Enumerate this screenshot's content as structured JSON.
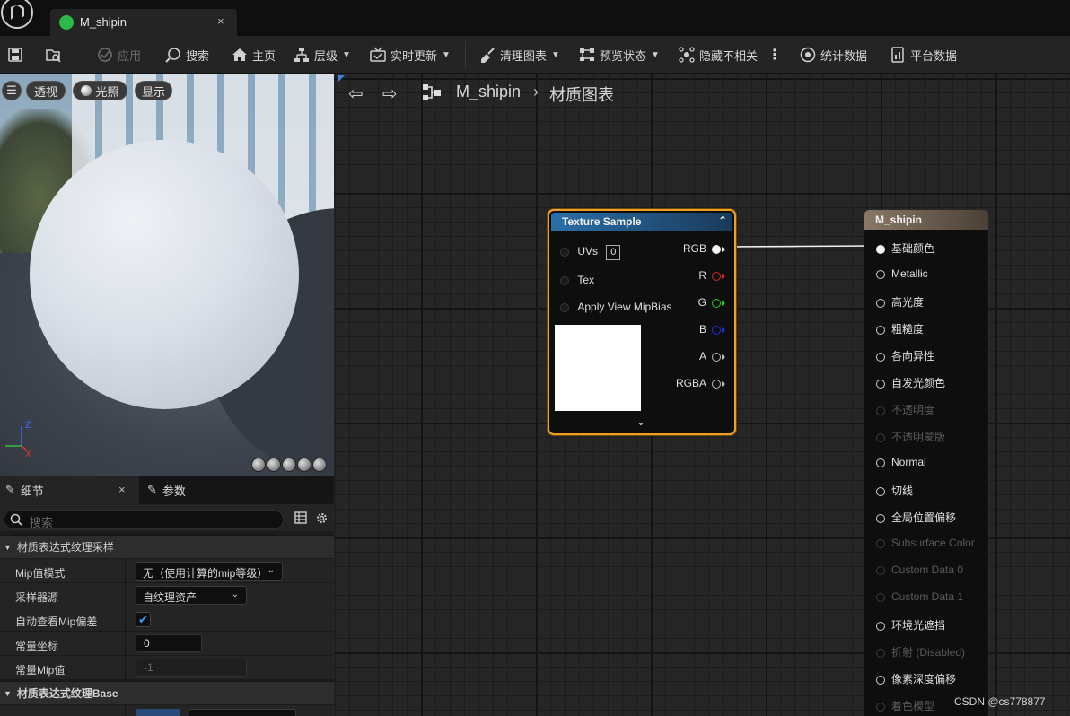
{
  "app": {
    "tab_title": "M_shipin",
    "tab_close": "×"
  },
  "toolbar": {
    "apply": "应用",
    "search": "搜索",
    "home": "主页",
    "hierarchy": "层级",
    "live_update": "实时更新",
    "clean_graph": "清理图表",
    "preview_state": "预览状态",
    "hide_unrelated": "隐藏不相关",
    "stats": "统计数据",
    "platform_stats": "平台数据"
  },
  "viewport": {
    "perspective": "透视",
    "lit": "光照",
    "show": "显示",
    "axis_z": "Z",
    "axis_x": "X"
  },
  "details": {
    "tab_details": "细节",
    "tab_close": "×",
    "tab_params": "参数",
    "search_placeholder": "搜索",
    "section_texture_sample": "材质表达式纹理采样",
    "mip_mode_label": "Mip值模式",
    "mip_mode_value": "无（使用计算的mip等级）",
    "sampler_source_label": "采样器源",
    "sampler_source_value": "自纹理资产",
    "auto_mip_label": "自动查看Mip偏差",
    "auto_mip_checked": true,
    "const_coord_label": "常量坐标",
    "const_coord_value": "0",
    "const_mip_label": "常量Mip值",
    "const_mip_value": "-1",
    "section_texture_base": "材质表达式纹理Base"
  },
  "graph": {
    "breadcrumb_root": "M_shipin",
    "breadcrumb_sep": "›",
    "breadcrumb_current": "材质图表",
    "texture_node": {
      "title": "Texture Sample",
      "inputs": [
        "UVs",
        "Tex",
        "Apply View MipBias"
      ],
      "uv_value": "0",
      "outputs": [
        {
          "label": "RGB",
          "color": "#f5f5f5"
        },
        {
          "label": "R",
          "color": "#e02020"
        },
        {
          "label": "G",
          "color": "#20d020"
        },
        {
          "label": "B",
          "color": "#2030e0"
        },
        {
          "label": "A",
          "color": "#bdbdbd"
        },
        {
          "label": "RGBA",
          "color": "#bdbdbd"
        }
      ]
    },
    "material_node": {
      "title": "M_shipin",
      "pins": [
        {
          "label": "基础颜色",
          "enabled": true,
          "connected": true
        },
        {
          "label": "Metallic",
          "enabled": true
        },
        {
          "label": "高光度",
          "enabled": true
        },
        {
          "label": "粗糙度",
          "enabled": true
        },
        {
          "label": "各向异性",
          "enabled": true
        },
        {
          "label": "自发光颜色",
          "enabled": true
        },
        {
          "label": "不透明度",
          "enabled": false
        },
        {
          "label": "不透明蒙版",
          "enabled": false
        },
        {
          "label": "Normal",
          "enabled": true
        },
        {
          "label": "切线",
          "enabled": true
        },
        {
          "label": "全局位置偏移",
          "enabled": true
        },
        {
          "label": "Subsurface Color",
          "enabled": false
        },
        {
          "label": "Custom Data 0",
          "enabled": false
        },
        {
          "label": "Custom Data 1",
          "enabled": false
        },
        {
          "label": "环境光遮挡",
          "enabled": true
        },
        {
          "label": "折射 (Disabled)",
          "enabled": false
        },
        {
          "label": "像素深度偏移",
          "enabled": true
        },
        {
          "label": "着色模型",
          "enabled": false
        }
      ]
    }
  },
  "watermark": "CSDN @cs778877"
}
